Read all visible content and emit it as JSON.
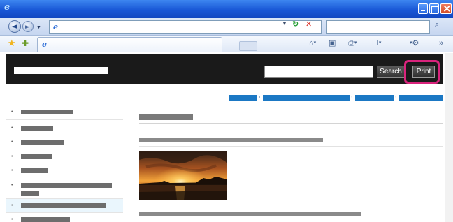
{
  "window": {
    "app_icon": "internet-explorer-icon",
    "controls": [
      "minimize-icon",
      "maximize-icon",
      "close-icon"
    ]
  },
  "address_bar": {
    "url": "",
    "icons": [
      "back-icon",
      "forward-icon",
      "refresh-icon",
      "stop-icon",
      "search-icon"
    ]
  },
  "favorites_bar": {
    "tab_title": "",
    "commands": [
      "home-icon",
      "feeds-icon",
      "print-icon",
      "page-menu-icon",
      "tools-menu-icon"
    ]
  },
  "site_header": {
    "search_value": "",
    "search_button_label": "Search",
    "print_button_label": "Print",
    "highlight_color": "#d9237c"
  },
  "breadcrumb": {
    "item_count": 4,
    "link_color": "#1b78c4"
  },
  "sidebar": {
    "item_count": 8,
    "active_index": 7
  },
  "main": {
    "photo": "sunset-over-sea-photo"
  }
}
